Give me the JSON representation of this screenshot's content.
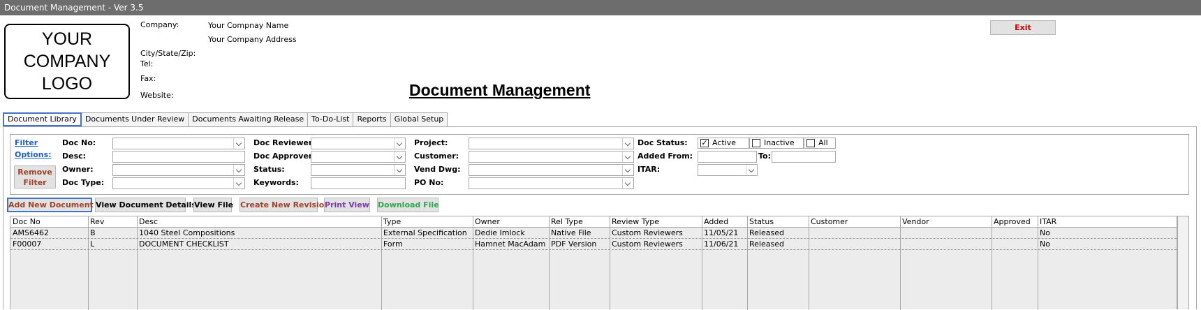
{
  "window": {
    "title": "Document Management - Ver 3.5"
  },
  "logo": {
    "line1": "YOUR",
    "line2": "COMPANY",
    "line3": "LOGO"
  },
  "company_info": {
    "company_label": "Company:",
    "company_value": "Your Compnay Name",
    "address_value": "Your Company Address",
    "city_label": "City/State/Zip:",
    "tel_label": "Tel:",
    "fax_label": "Fax:",
    "website_label": "Website:"
  },
  "header": {
    "title": "Document Management",
    "exit_label": "Exit"
  },
  "tabs": [
    {
      "label": "Document Library"
    },
    {
      "label": "Documents Under Review"
    },
    {
      "label": "Documents Awaiting Release"
    },
    {
      "label": "To-Do-List"
    },
    {
      "label": "Reports"
    },
    {
      "label": "Global Setup"
    }
  ],
  "filters": {
    "link_line1": "Filter",
    "link_line2": "Options:",
    "remove_line1": "Remove",
    "remove_line2": "Filter",
    "doc_no": "Doc No:",
    "desc": "Desc:",
    "owner": "Owner:",
    "doc_type": "Doc Type:",
    "doc_reviewer": "Doc Reviewer:",
    "doc_approver": "Doc Approver:",
    "status": "Status:",
    "keywords": "Keywords:",
    "project": "Project:",
    "customer": "Customer:",
    "vend_dwg": "Vend Dwg:",
    "po_no": "PO No:",
    "doc_status": "Doc Status:",
    "added_from": "Added From:",
    "to": "To:",
    "itar": "ITAR:",
    "status_active": "Active",
    "status_inactive": "Inactive",
    "status_all": "All",
    "active_checked": true
  },
  "actions": {
    "add_new": "Add New Document",
    "view_details": "View Document Details",
    "view_file": "View File",
    "create_revision": "Create New Revision",
    "print_view": "Print View",
    "download_file": "Download File"
  },
  "colors": {
    "add_new": "#a0422a",
    "create_revision": "#a0422a",
    "print_view": "#7a3aa6",
    "download_file": "#2ea84a",
    "exit": "#cc0000",
    "link": "#1f5fbf"
  },
  "table": {
    "columns": [
      "Doc No",
      "Rev",
      "Desc",
      "Type",
      "Owner",
      "Rel Type",
      "Review Type",
      "Added",
      "Status",
      "Customer",
      "Vendor",
      "Approved",
      "ITAR"
    ],
    "rows": [
      [
        "AMS6462",
        "B",
        "1040 Steel Compositions",
        "External Specification",
        "Dedie Imlock",
        "Native File",
        "Custom Reviewers",
        "11/05/21",
        "Released",
        "",
        "",
        "",
        "No"
      ],
      [
        "F00007",
        "L",
        "DOCUMENT CHECKLIST",
        "Form",
        "Hamnet MacAdam",
        "PDF Version",
        "Custom Reviewers",
        "11/06/21",
        "Released",
        "",
        "",
        "",
        "No"
      ]
    ]
  }
}
